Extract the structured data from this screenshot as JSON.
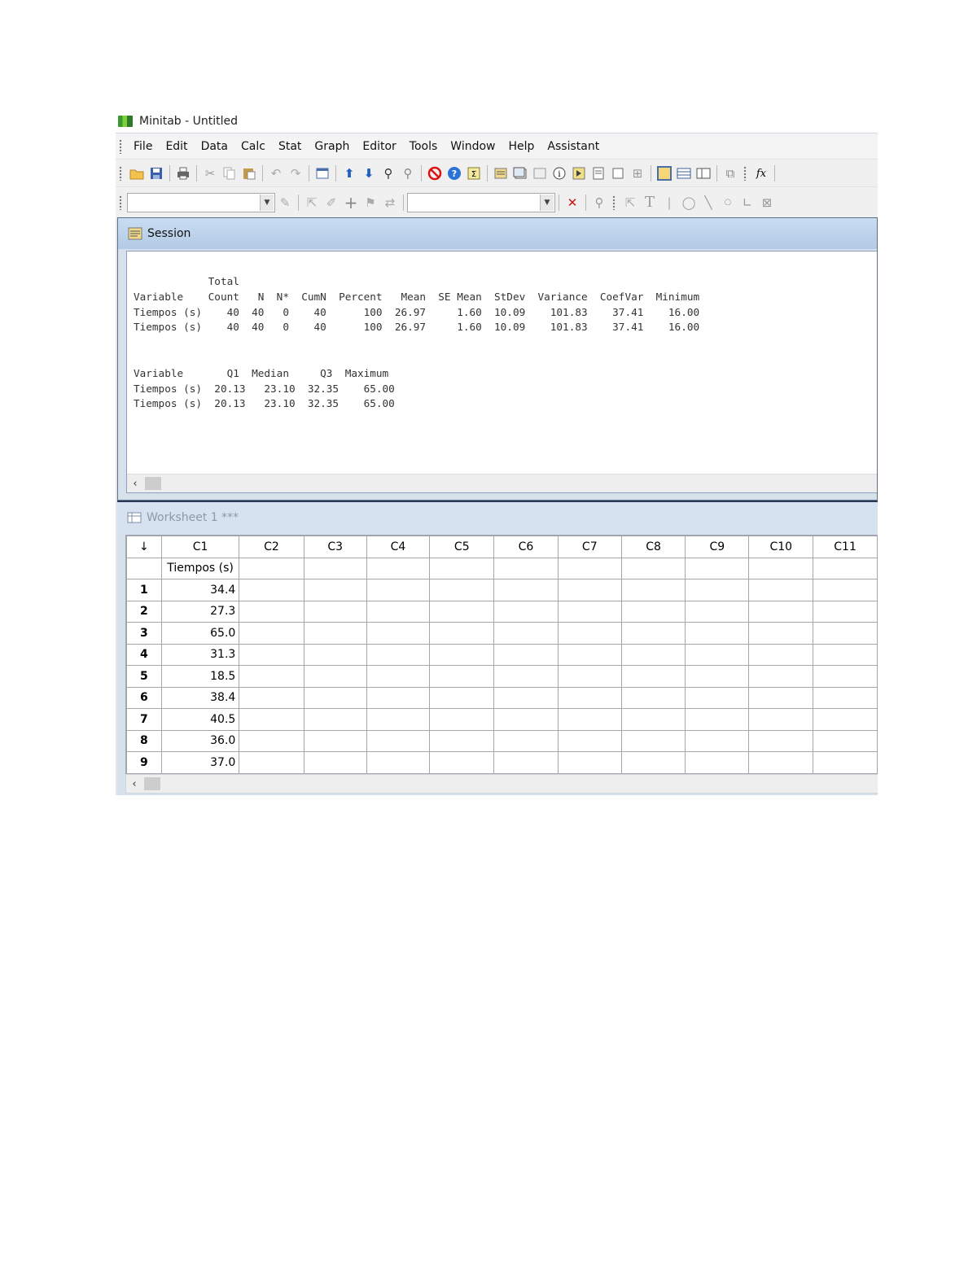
{
  "window": {
    "title": "Minitab - Untitled"
  },
  "menu": [
    "File",
    "Edit",
    "Data",
    "Calc",
    "Stat",
    "Graph",
    "Editor",
    "Tools",
    "Window",
    "Help",
    "Assistant"
  ],
  "toolbar": {
    "row1_icons": [
      "open-icon",
      "save-icon",
      "print-icon",
      "cut-icon",
      "copy-icon",
      "paste-icon",
      "undo-icon",
      "redo-icon",
      "window-icon",
      "arrow-up-icon",
      "arrow-down-icon",
      "find-icon",
      "find-next-icon",
      "cancel-icon",
      "help-icon",
      "sigma-icon",
      "session-icon",
      "data-window-icon",
      "info-icon",
      "history-icon",
      "report-icon",
      "new-window-icon",
      "manage-icon",
      "layout-icon",
      "column-icon",
      "function-icon"
    ],
    "row2_icons": [
      "brush-icon",
      "select-icon",
      "pen-icon",
      "crosshair-icon",
      "flag-icon",
      "swap-icon",
      "delete-icon",
      "zoom-icon",
      "pointer-icon",
      "text-icon",
      "ellipse-icon",
      "line-icon",
      "dot-icon",
      "polyline-icon",
      "polygon-icon"
    ]
  },
  "session": {
    "title": "Session",
    "output": "            Total\nVariable    Count   N  N*  CumN  Percent   Mean  SE Mean  StDev  Variance  CoefVar  Minimum\nTiempos (s)    40  40   0    40      100  26.97     1.60  10.09    101.83    37.41    16.00\nTiempos (s)    40  40   0    40      100  26.97     1.60  10.09    101.83    37.41    16.00\n\n\nVariable       Q1  Median     Q3  Maximum\nTiempos (s)  20.13   23.10  32.35    65.00\nTiempos (s)  20.13   23.10  32.35    65.00"
  },
  "worksheet": {
    "title": "Worksheet 1 ***",
    "corner": "↓",
    "columns": [
      "C1",
      "C2",
      "C3",
      "C4",
      "C5",
      "C6",
      "C7",
      "C8",
      "C9",
      "C10",
      "C11"
    ],
    "column_names": [
      "Tiempos (s)",
      "",
      "",
      "",
      "",
      "",
      "",
      "",
      "",
      "",
      ""
    ],
    "rows": [
      {
        "n": "1",
        "c1": "34.4"
      },
      {
        "n": "2",
        "c1": "27.3"
      },
      {
        "n": "3",
        "c1": "65.0"
      },
      {
        "n": "4",
        "c1": "31.3"
      },
      {
        "n": "5",
        "c1": "18.5"
      },
      {
        "n": "6",
        "c1": "38.4"
      },
      {
        "n": "7",
        "c1": "40.5"
      },
      {
        "n": "8",
        "c1": "36.0"
      },
      {
        "n": "9",
        "c1": "37.0"
      }
    ]
  },
  "scroll_left": "‹"
}
